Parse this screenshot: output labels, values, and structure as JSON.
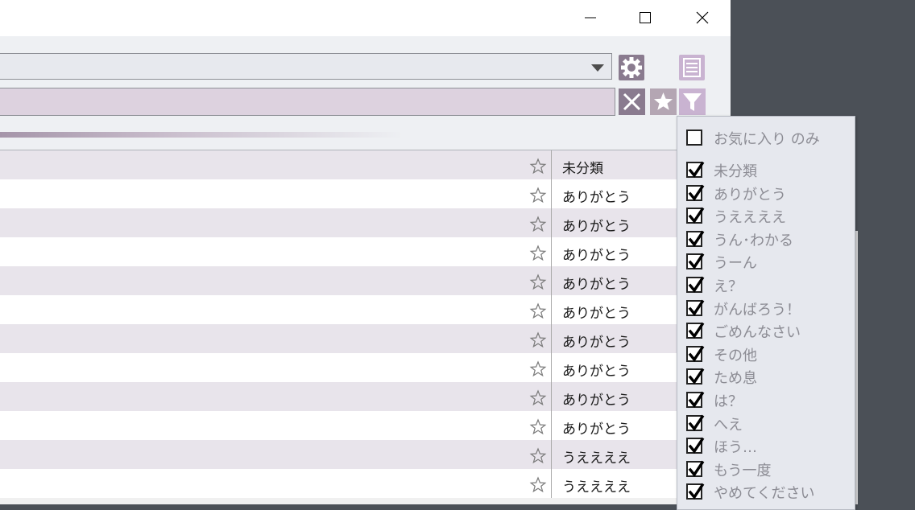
{
  "window": {
    "controls": {
      "minimize_icon": "minimize-icon",
      "maximize_icon": "maximize-icon",
      "close_icon": "close-icon"
    }
  },
  "toolbar": {
    "combo_value": "",
    "search_value": "",
    "icons": [
      "chevron-down-icon",
      "gear-icon",
      "menu-icon",
      "clear-icon",
      "star-icon",
      "filter-icon"
    ]
  },
  "list": {
    "rows": [
      {
        "category": "未分類",
        "favorite": false
      },
      {
        "category": "ありがとう",
        "favorite": false
      },
      {
        "category": "ありがとう",
        "favorite": false
      },
      {
        "category": "ありがとう",
        "favorite": false
      },
      {
        "category": "ありがとう",
        "favorite": false
      },
      {
        "category": "ありがとう",
        "favorite": false
      },
      {
        "category": "ありがとう",
        "favorite": false
      },
      {
        "category": "ありがとう",
        "favorite": false
      },
      {
        "category": "ありがとう",
        "favorite": false
      },
      {
        "category": "ありがとう",
        "favorite": false
      },
      {
        "category": "うええええ",
        "favorite": false
      },
      {
        "category": "うええええ",
        "favorite": false
      }
    ]
  },
  "filter_popup": {
    "favorites_only": {
      "label": "お気に入り のみ",
      "checked": false
    },
    "categories": [
      {
        "label": "未分類",
        "checked": true
      },
      {
        "label": "ありがとう",
        "checked": true
      },
      {
        "label": "うええええ",
        "checked": true
      },
      {
        "label": "うん･わかる",
        "checked": true
      },
      {
        "label": "うーん",
        "checked": true
      },
      {
        "label": "え？",
        "checked": true
      },
      {
        "label": "がんばろう！",
        "checked": true
      },
      {
        "label": "ごめんなさい",
        "checked": true
      },
      {
        "label": "その他",
        "checked": true
      },
      {
        "label": "ため息",
        "checked": true
      },
      {
        "label": "は？",
        "checked": true
      },
      {
        "label": "へえ",
        "checked": true
      },
      {
        "label": "ほう…",
        "checked": true
      },
      {
        "label": "もう一度",
        "checked": true
      },
      {
        "label": "やめてください",
        "checked": true
      }
    ]
  },
  "colors": {
    "accent": "#8a7b8f",
    "accent_light": "#c9b3d1",
    "row_alt": "#e8e4eb",
    "search_bg": "#ddd2df",
    "desktop": "#4b5057"
  }
}
